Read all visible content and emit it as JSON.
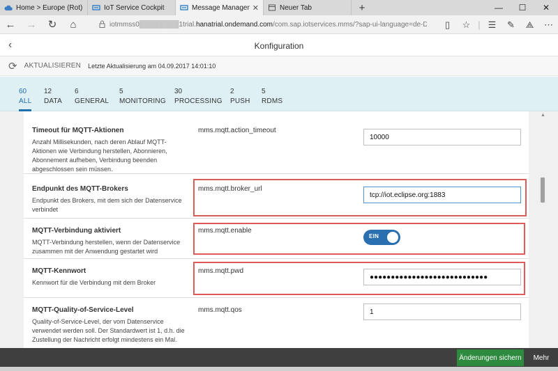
{
  "browser": {
    "tabs": [
      {
        "label": "Home > Europe (Rot) - Trial",
        "icon": "cloud-icon",
        "active": false
      },
      {
        "label": "IoT Service Cockpit",
        "icon": "iot-icon",
        "active": false
      },
      {
        "label": "Message Management",
        "icon": "iot-icon",
        "active": true
      },
      {
        "label": "Neuer Tab",
        "icon": "page-icon",
        "active": false
      }
    ],
    "new_tab": "+",
    "window_controls": {
      "minimize": "—",
      "maximize": "☐",
      "close": "✕"
    },
    "url_prefix": "iotmmss0",
    "url_masked": "████████",
    "url_mid": "1trial.",
    "url_host": "hanatrial.ondemand.com",
    "url_rest": "/com.sap.iotservices.mms/?sap-ui-language=de-DE#/config"
  },
  "header": {
    "title": "Konfiguration"
  },
  "refresh": {
    "button": "AKTUALISIEREN",
    "last_update": "Letzte Aktualisierung am 04.09.2017 14:01:10"
  },
  "filters": [
    {
      "count": "60",
      "name": "ALL",
      "selected": true
    },
    {
      "count": "12",
      "name": "DATA",
      "selected": false
    },
    {
      "count": "6",
      "name": "GENERAL",
      "selected": false
    },
    {
      "count": "5",
      "name": "MONITORING",
      "selected": false
    },
    {
      "count": "30",
      "name": "PROCESSING",
      "selected": false
    },
    {
      "count": "2",
      "name": "PUSH",
      "selected": false
    },
    {
      "count": "5",
      "name": "RDMS",
      "selected": false
    }
  ],
  "settings": [
    {
      "title": "Timeout für MQTT-Aktionen",
      "desc": "Anzahl Millisekunden, nach deren Ablauf MQTT-Aktionen wie Verbindung herstellen, Abonnieren, Abonnement aufheben, Verbindung beenden abgeschlossen sein müssen.",
      "key": "mms.mqtt.action_timeout",
      "value": "10000"
    },
    {
      "title": "Endpunkt des MQTT-Brokers",
      "desc": "Endpunkt des Brokers, mit dem sich der Datenservice verbindet",
      "key": "mms.mqtt.broker_url",
      "value": "tcp://iot.eclipse.org:1883"
    },
    {
      "title": "MQTT-Verbindung aktiviert",
      "desc": "MQTT-Verbindung herstellen, wenn der Datenservice zusammen mit der Anwendung gestartet wird",
      "key": "mms.mqtt.enable",
      "toggle_label": "EIN"
    },
    {
      "title": "MQTT-Kennwort",
      "desc": "Kennwort für die Verbindung mit dem Broker",
      "key": "mms.mqtt.pwd",
      "value": "●●●●●●●●●●●●●●●●●●●●●●●●●●●●"
    },
    {
      "title": "MQTT-Quality-of-Service-Level",
      "desc": "Quality-of-Service-Level, der vom Datenservice verwendet werden soll. Der Standardwert ist 1, d.h. die Zustellung der Nachricht erfolgt mindestens ein Mal.",
      "key": "mms.mqtt.qos",
      "value": "1"
    }
  ],
  "footer": {
    "save": "Änderungen sichern",
    "more": "Mehr"
  }
}
